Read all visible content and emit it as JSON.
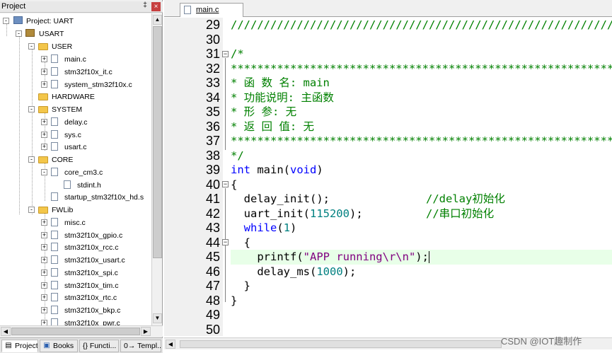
{
  "project_panel": {
    "title": "Project",
    "pin_glyph": "‡",
    "close_glyph": "×",
    "tree": [
      {
        "label": "Project: UART",
        "icon": "project-icon",
        "expand": "-"
      },
      {
        "label": "USART",
        "icon": "target-icon",
        "expand": "-"
      },
      {
        "label": "USER",
        "icon": "folder-icon",
        "expand": "-"
      },
      {
        "label": "main.c",
        "icon": "file-icon",
        "expand": "+"
      },
      {
        "label": "stm32f10x_it.c",
        "icon": "file-icon",
        "expand": "+"
      },
      {
        "label": "system_stm32f10x.c",
        "icon": "file-icon",
        "expand": "+"
      },
      {
        "label": "HARDWARE",
        "icon": "folder-icon",
        "expand": ""
      },
      {
        "label": "SYSTEM",
        "icon": "folder-icon",
        "expand": "-"
      },
      {
        "label": "delay.c",
        "icon": "file-icon",
        "expand": "+"
      },
      {
        "label": "sys.c",
        "icon": "file-icon",
        "expand": "+"
      },
      {
        "label": "usart.c",
        "icon": "file-icon",
        "expand": "+"
      },
      {
        "label": "CORE",
        "icon": "folder-icon",
        "expand": "-"
      },
      {
        "label": "core_cm3.c",
        "icon": "file-icon",
        "expand": "-"
      },
      {
        "label": "stdint.h",
        "icon": "file-icon",
        "expand": ""
      },
      {
        "label": "startup_stm32f10x_hd.s",
        "icon": "file-icon",
        "expand": ""
      },
      {
        "label": "FWLib",
        "icon": "folder-icon",
        "expand": "-"
      },
      {
        "label": "misc.c",
        "icon": "file-icon",
        "expand": "+"
      },
      {
        "label": "stm32f10x_gpio.c",
        "icon": "file-icon",
        "expand": "+"
      },
      {
        "label": "stm32f10x_rcc.c",
        "icon": "file-icon",
        "expand": "+"
      },
      {
        "label": "stm32f10x_usart.c",
        "icon": "file-icon",
        "expand": "+"
      },
      {
        "label": "stm32f10x_spi.c",
        "icon": "file-icon",
        "expand": "+"
      },
      {
        "label": "stm32f10x_tim.c",
        "icon": "file-icon",
        "expand": "+"
      },
      {
        "label": "stm32f10x_rtc.c",
        "icon": "file-icon",
        "expand": "+"
      },
      {
        "label": "stm32f10x_bkp.c",
        "icon": "file-icon",
        "expand": "+"
      },
      {
        "label": "stm32f10x_pwr.c",
        "icon": "file-icon",
        "expand": "+"
      }
    ],
    "bottom_tabs": [
      {
        "label": "Project",
        "glyph": "▤"
      },
      {
        "label": "Books",
        "glyph": "▣"
      },
      {
        "label": "{} Functi...",
        "glyph": ""
      },
      {
        "label": "0→ Templ...",
        "glyph": ""
      }
    ]
  },
  "editor": {
    "tab_label": "main.c",
    "line_numbers": [
      "29",
      "30",
      "31",
      "32",
      "33",
      "34",
      "35",
      "36",
      "37",
      "38",
      "39",
      "40",
      "41",
      "42",
      "43",
      "44",
      "45",
      "46",
      "47",
      "48",
      "49",
      "50"
    ],
    "code": {
      "l29": "////////////////////////////////////////////////////////////",
      "l31": "/*",
      "l32": "*****************************************************************",
      "l33": "* 函 数 名: main",
      "l34": "* 功能说明: 主函数",
      "l35": "* 形 参: 无",
      "l36": "* 返 回 值: 无",
      "l37": "*****************************************************************",
      "l38": "*/",
      "l39_kw1": "int",
      "l39_mid": " main(",
      "l39_kw2": "void",
      "l39_end": ")",
      "l40": "{",
      "l41_code": "  delay_init();",
      "l41_cmt": "//delay初始化",
      "l42_code": "  uart_init(",
      "l42_num": "115200",
      "l42_end": ");",
      "l42_cmt": "//串口初始化",
      "l43_kw": "while",
      "l43_open": "(",
      "l43_num": "1",
      "l43_close": ")",
      "l44": "  {",
      "l45_code": "    printf(",
      "l45_str": "\"APP running\\r\\n\"",
      "l45_end": ");",
      "l46_code": "    delay_ms(",
      "l46_num": "1000",
      "l46_end": ");",
      "l47": "  }",
      "l48": "}"
    }
  },
  "watermark": "CSDN @IOT趣制作"
}
